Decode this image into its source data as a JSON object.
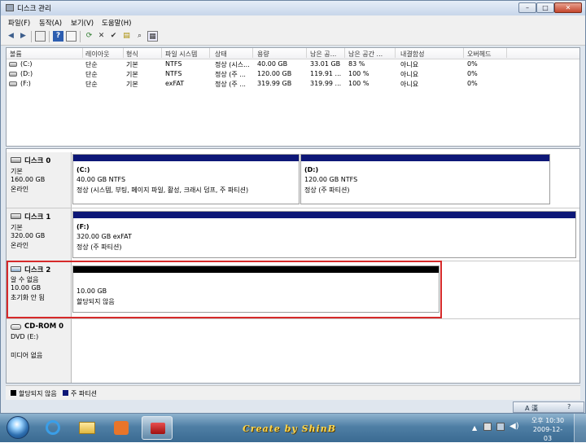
{
  "window": {
    "title": "디스크 관리",
    "controls": {
      "minimize": "–",
      "maximize": "□",
      "close": "✕"
    }
  },
  "menu": [
    "파일(F)",
    "동작(A)",
    "보기(V)",
    "도움말(H)"
  ],
  "list": {
    "columns": [
      "볼륨",
      "레이아웃",
      "형식",
      "파일 시스템",
      "상태",
      "용량",
      "남은 공...",
      "남은 공간 ...",
      "내결함성",
      "오버헤드"
    ],
    "rows": [
      [
        "(C:)",
        "단순",
        "기본",
        "NTFS",
        "정상 (시스...",
        "40.00 GB",
        "33.01 GB",
        "83 %",
        "아니요",
        "0%"
      ],
      [
        "(D:)",
        "단순",
        "기본",
        "NTFS",
        "정상 (주 ...",
        "120.00 GB",
        "119.91 ...",
        "100 %",
        "아니요",
        "0%"
      ],
      [
        "(F:)",
        "단순",
        "기본",
        "exFAT",
        "정상 (주 ...",
        "319.99 GB",
        "319.99 ...",
        "100 %",
        "아니요",
        "0%"
      ]
    ]
  },
  "disks": [
    {
      "name": "디스크 0",
      "lines": [
        "기본",
        "160.00 GB",
        "온라인"
      ],
      "parts": [
        {
          "title": "(C:)",
          "size": "40.00 GB NTFS",
          "status": "정상 (시스템, 부팅, 페이지 파일, 활성, 크래시 덤프, 주 파티션)"
        },
        {
          "title": "(D:)",
          "size": "120.00 GB NTFS",
          "status": "정상 (주 파티션)"
        }
      ]
    },
    {
      "name": "디스크 1",
      "lines": [
        "기본",
        "320.00 GB",
        "온라인"
      ],
      "parts": [
        {
          "title": "(F:)",
          "size": "320.00 GB exFAT",
          "status": "정상 (주 파티션)"
        }
      ]
    },
    {
      "name": "디스크 2",
      "lines": [
        "알 수 없음",
        "10.00 GB",
        "초기화 안 됨"
      ],
      "parts": [
        {
          "size": "10.00 GB",
          "status": "할당되지 않음"
        }
      ]
    },
    {
      "name": "CD-ROM 0",
      "lines": [
        "DVD (E:)",
        "미디어 없음"
      ]
    }
  ],
  "legend": {
    "unallocated": "할당되지 않음",
    "primary": "주 파티션",
    "colors": {
      "unallocated": "#000000",
      "primary": "#0d1777"
    }
  },
  "taskbar": {
    "credit": "Create  by  ShinB",
    "time": "오후 10:30",
    "date": "2009-12-03",
    "lang": "A 漢"
  },
  "highlight_color": "#d62a2a"
}
